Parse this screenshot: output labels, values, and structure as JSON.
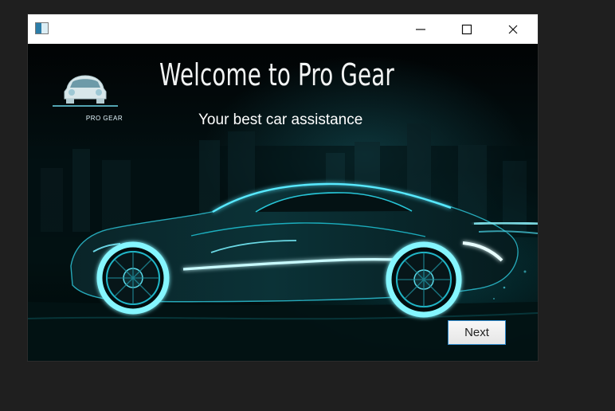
{
  "window": {
    "title": "",
    "controls": {
      "minimize": "minimize-icon",
      "maximize": "maximize-icon",
      "close": "close-icon"
    }
  },
  "main": {
    "headline": "Welcome to Pro Gear",
    "subtitle": "Your best car assistance",
    "logo_text": "PRO GEAR",
    "next_label": "Next"
  },
  "colors": {
    "accent": "#2d89cc",
    "neon": "#38d8ee",
    "background": "#000000"
  }
}
